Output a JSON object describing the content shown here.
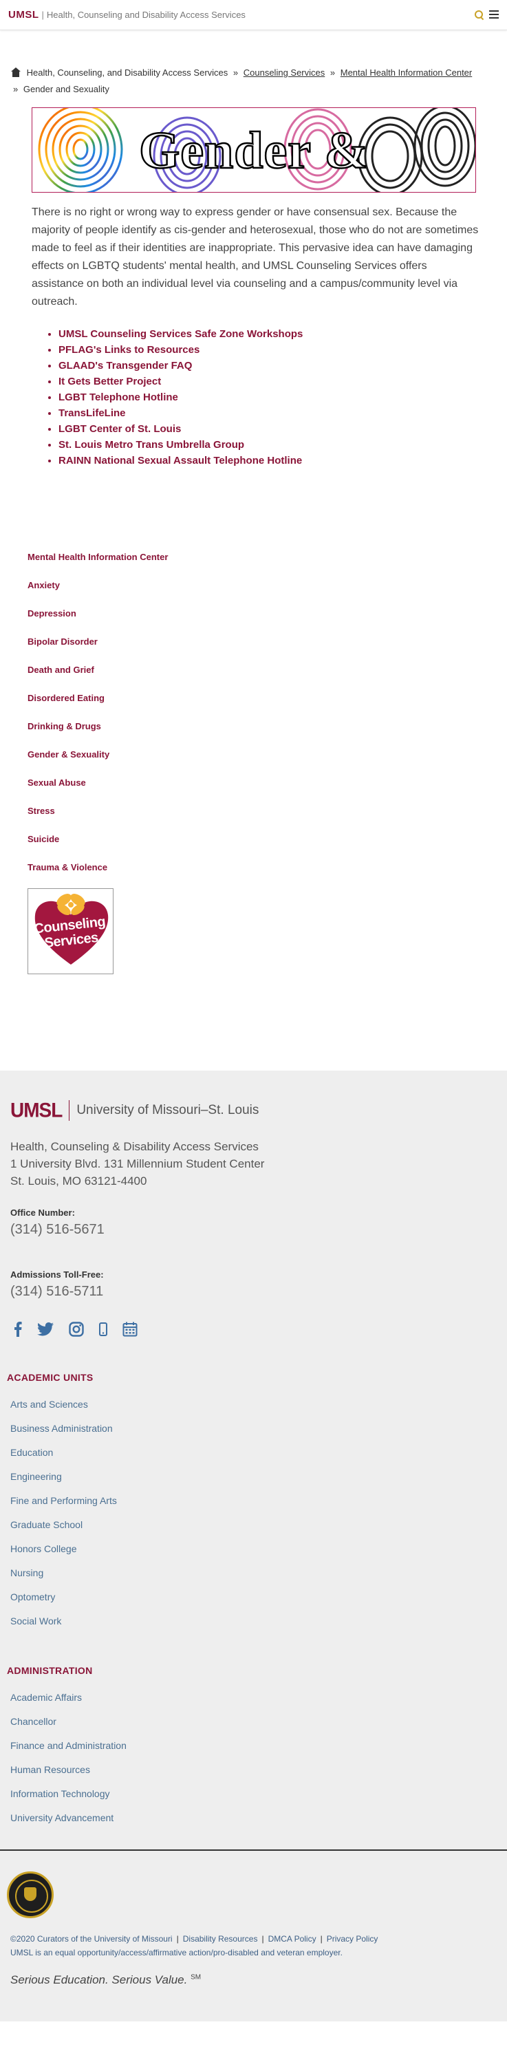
{
  "header": {
    "brand": "UMSL",
    "separator": "|",
    "department": "Health, Counseling and Disability Access Services"
  },
  "breadcrumb": {
    "items": [
      "Health, Counseling, and Disability Access Services",
      "Counseling Services",
      "Mental Health Information Center",
      "Gender and Sexuality"
    ],
    "separator": "»"
  },
  "banner": {
    "title": "Gender & Sexuality"
  },
  "intro": "There is no right or wrong way to express gender or have consensual sex.  Because the majority of people identify as cis-gender and heterosexual, those who do not are sometimes made to feel as if their identities are inappropriate.  This pervasive idea can have damaging effects on LGBTQ students' mental health, and UMSL Counseling Services offers assistance on both an individual level via counseling and a campus/community level via outreach.",
  "resources": [
    "UMSL Counseling Services Safe Zone Workshops",
    "PFLAG's Links to Resources",
    "GLAAD's Transgender FAQ",
    "It Gets Better Project",
    "LGBT Telephone Hotline",
    "TransLifeLine",
    "LGBT Center of St. Louis",
    "St. Louis Metro Trans Umbrella Group",
    "RAINN National Sexual Assault Telephone Hotline"
  ],
  "sidenav": [
    "Mental Health Information Center",
    "Anxiety",
    "Depression",
    "Bipolar Disorder",
    "Death and Grief",
    "Disordered Eating",
    "Drinking & Drugs",
    "Gender & Sexuality",
    "Sexual Abuse",
    "Stress",
    "Suicide",
    "Trauma & Violence"
  ],
  "counseling_logo": {
    "line1": "Counseling",
    "line2": "Services"
  },
  "footer": {
    "logo_text": "UMSL",
    "university_name": "University of Missouri–St. Louis",
    "address": [
      "Health, Counseling & Disability Access Services",
      "1 University Blvd. 131 Millennium Student Center",
      "St. Louis, MO 63121-4400"
    ],
    "office_label": "Office Number:",
    "office_phone": "(314) 516-5671",
    "admissions_label": "Admissions Toll-Free:",
    "admissions_phone": "(314) 516-5711",
    "social_icons": [
      "facebook-icon",
      "twitter-icon",
      "instagram-icon",
      "mobile-icon",
      "calendar-icon"
    ],
    "academic_heading": "ACADEMIC UNITS",
    "academic_units": [
      "Arts and Sciences",
      "Business Administration",
      "Education",
      "Engineering",
      "Fine and Performing Arts",
      "Graduate School",
      "Honors College",
      "Nursing",
      "Optometry",
      "Social Work"
    ],
    "admin_heading": "ADMINISTRATION",
    "admin_units": [
      "Academic Affairs",
      "Chancellor",
      "Finance and Administration",
      "Human Resources",
      "Information Technology",
      "University Advancement"
    ],
    "legal_links": [
      "©2020 Curators of the University of Missouri",
      "Disability Resources",
      "DMCA Policy",
      "Privacy Policy"
    ],
    "eeo": "UMSL is an equal opportunity/access/affirmative action/pro-disabled and veteran employer.",
    "tagline": "Serious Education. Serious Value.",
    "tagline_mark": "SM"
  },
  "colors": {
    "brand": "#8a1538",
    "link_blue": "#4a6f91",
    "gold": "#c9a227"
  }
}
